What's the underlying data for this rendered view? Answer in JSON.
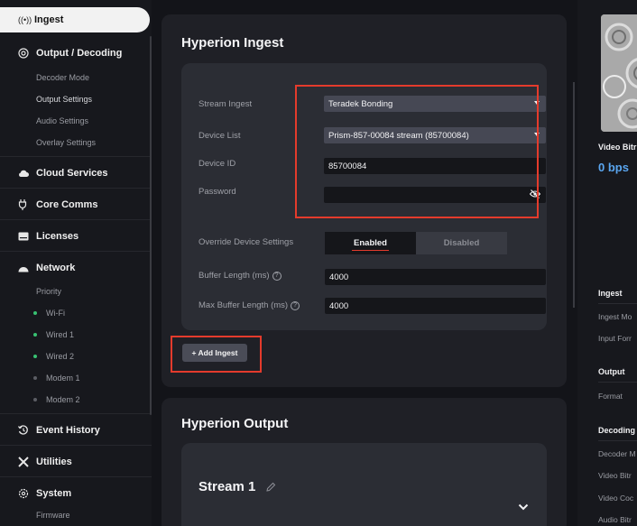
{
  "sidebar": {
    "active": {
      "icon": "broadcast-icon",
      "label": "Ingest"
    },
    "output_decoding": {
      "label": "Output / Decoding",
      "items": [
        "Decoder Mode",
        "Output Settings",
        "Audio Settings",
        "Overlay Settings"
      ]
    },
    "cloud": {
      "label": "Cloud Services"
    },
    "core": {
      "label": "Core Comms"
    },
    "licenses": {
      "label": "Licenses"
    },
    "network": {
      "label": "Network",
      "priority": "Priority",
      "items": [
        {
          "label": "Wi-Fi",
          "status_color": "#38c172"
        },
        {
          "label": "Wired 1",
          "status_color": "#38c172"
        },
        {
          "label": "Wired 2",
          "status_color": "#38c172"
        },
        {
          "label": "Modem 1",
          "status_color": "#5b5d64"
        },
        {
          "label": "Modem 2",
          "status_color": "#5b5d64"
        }
      ]
    },
    "event_history": {
      "label": "Event History"
    },
    "utilities": {
      "label": "Utilities"
    },
    "system": {
      "label": "System",
      "items": [
        "Firmware"
      ]
    }
  },
  "ingest": {
    "title": "Hyperion Ingest",
    "stream_ingest": {
      "label": "Stream Ingest",
      "value": "Teradek Bonding"
    },
    "device_list": {
      "label": "Device List",
      "value": "Prism-857-00084 stream (85700084)"
    },
    "device_id": {
      "label": "Device ID",
      "value": "85700084"
    },
    "password": {
      "label": "Password",
      "value": ""
    },
    "override": {
      "label": "Override Device Settings",
      "enabled": "Enabled",
      "disabled": "Disabled"
    },
    "buffer": {
      "label": "Buffer Length (ms)",
      "value": "4000"
    },
    "max_buffer": {
      "label": "Max Buffer Length (ms)",
      "value": "4000"
    },
    "add_button": "+ Add Ingest"
  },
  "output": {
    "title": "Hyperion Output",
    "stream_title": "Stream 1"
  },
  "right_panel": {
    "video_bitrate_label": "Video Bitr",
    "video_bitrate_value": "0 bps",
    "ingest_head": "Ingest",
    "ingest_items": [
      "Ingest Mo",
      "Input Forr"
    ],
    "output_head": "Output",
    "output_items": [
      "Format"
    ],
    "decoding_head": "Decoding",
    "decoding_items": [
      "Decoder M",
      "Video Bitr",
      "Video Coc",
      "Audio Bitr"
    ]
  },
  "colors": {
    "accent_red": "#e43b2c",
    "bitrate_blue": "#5aa6f0",
    "status_green": "#38c172"
  }
}
